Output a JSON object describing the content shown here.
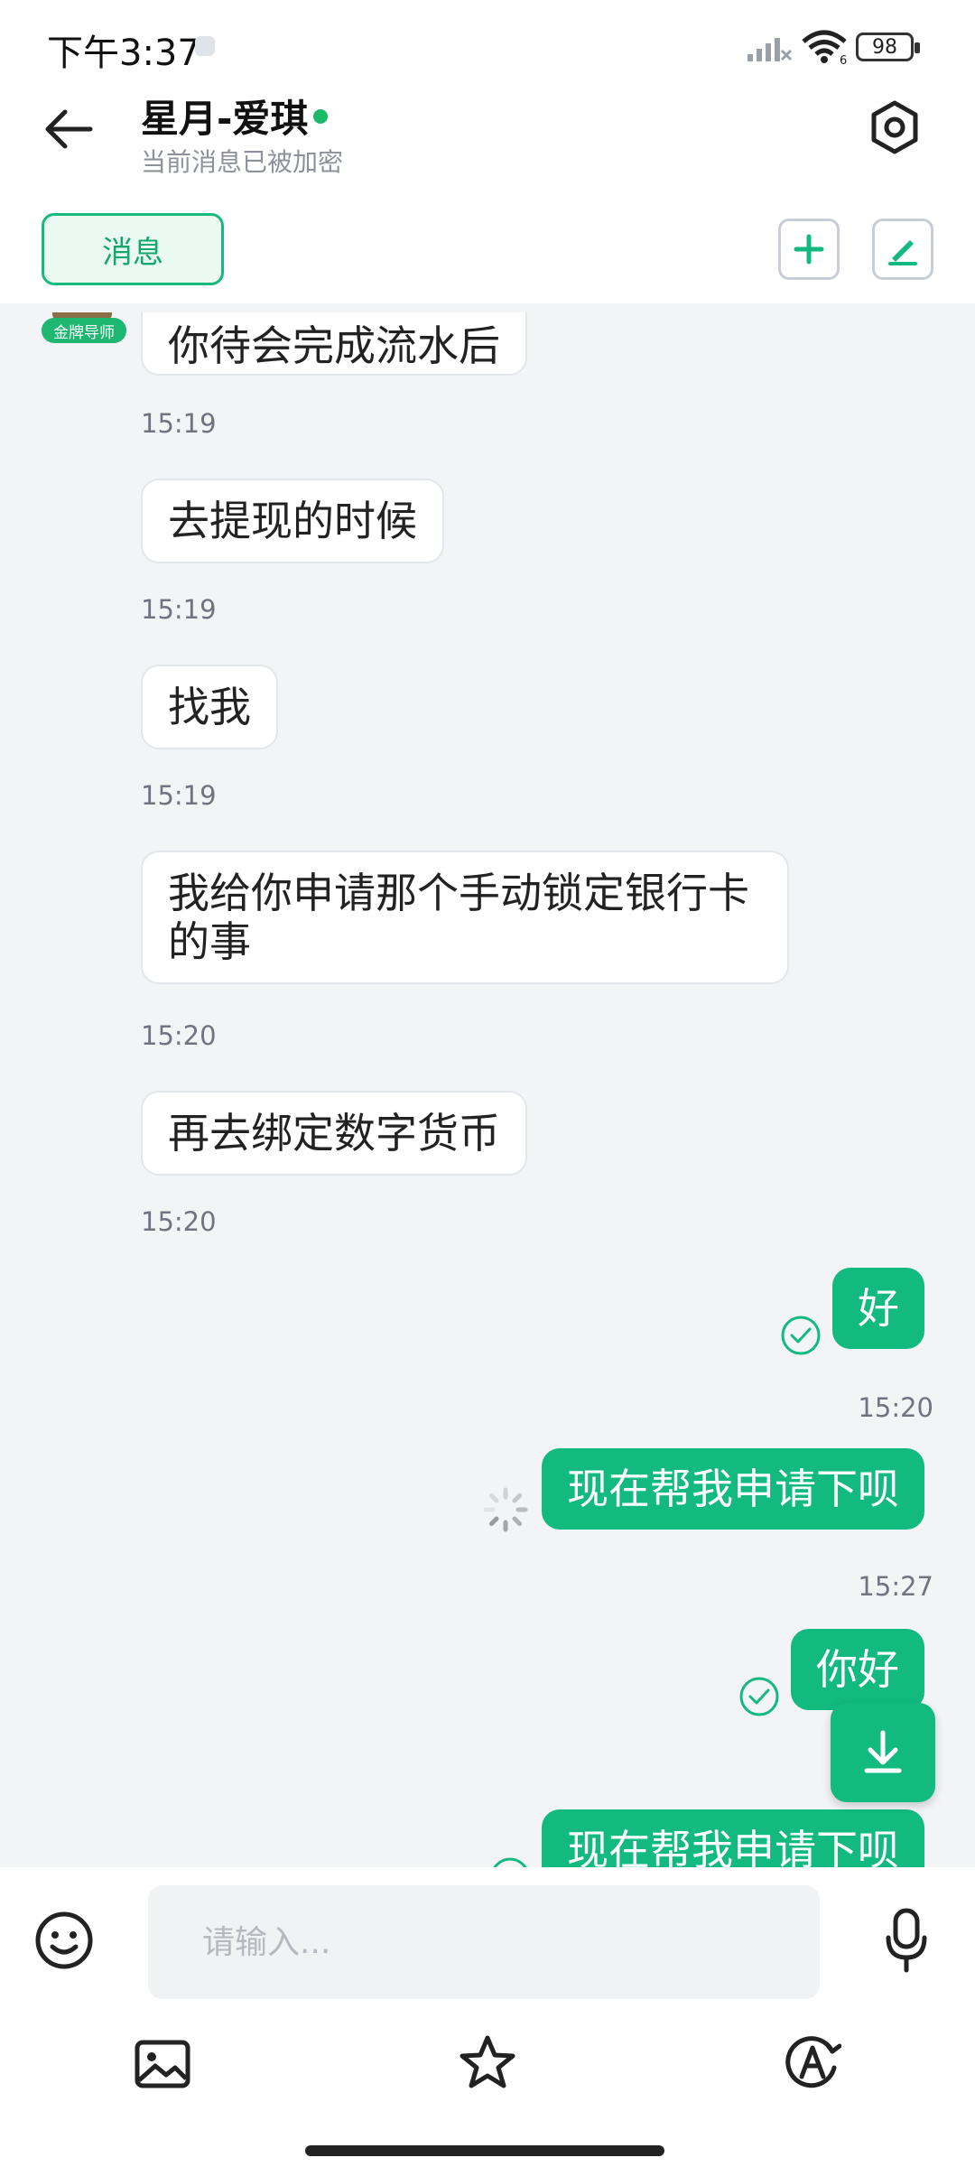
{
  "status_bar": {
    "time": "下午3:37",
    "battery": "98",
    "network_label": "6"
  },
  "header": {
    "title": "星月-爱琪",
    "subtitle": "当前消息已被加密",
    "tab_label": "消息"
  },
  "avatar_badge": "金牌导师",
  "messages": [
    {
      "text": "你待会完成流水后",
      "time": "15:19"
    },
    {
      "text": "去提现的时候",
      "time": "15:19"
    },
    {
      "text": "找我",
      "time": "15:19"
    },
    {
      "text": "我给你申请那个手动锁定银行卡的事",
      "time": "15:20"
    },
    {
      "text": "再去绑定数字货币",
      "time": "15:20"
    },
    {
      "text": "好",
      "time": "15:20",
      "status": "read"
    },
    {
      "text": "现在帮我申请下呗",
      "time": "15:27",
      "status": "sending"
    },
    {
      "text": "你好",
      "status": "read"
    },
    {
      "text": "现在帮我申请下呗",
      "status": "read"
    }
  ],
  "input": {
    "placeholder": "请输入..."
  },
  "colors": {
    "accent": "#12ba80",
    "online": "#1aba69",
    "background": "#f3f4f6"
  },
  "icons": [
    "back-arrow-icon",
    "settings-hexagon-icon",
    "plus-icon",
    "pen-icon",
    "check-circle-icon",
    "loading-spinner-icon",
    "download-arrow-icon",
    "emoji-icon",
    "microphone-icon",
    "image-icon",
    "star-icon",
    "translate-icon"
  ]
}
